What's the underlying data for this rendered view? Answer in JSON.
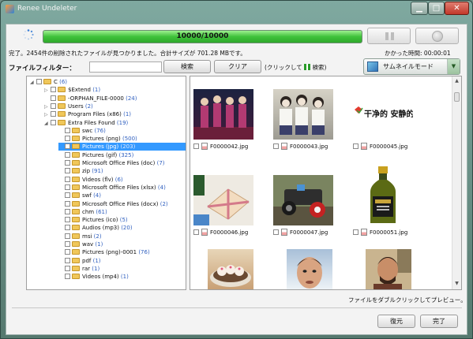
{
  "app": {
    "title": "Renee Undeleter"
  },
  "window_controls": {
    "minimize": "▁",
    "maximize": "□",
    "close": "✕"
  },
  "progress": {
    "text": "10000/10000",
    "fraction": 1.0
  },
  "status": {
    "message": "完了。2454件の削除されたファイルが見つかりました。合計サイズが 701.28 MBです。",
    "elapsed_label": "かかった時間:",
    "elapsed_value": "00:00:01"
  },
  "filter": {
    "label": "ファイルフィルター：",
    "value": "",
    "search_label": "検索",
    "clear_label": "クリア",
    "hint_prefix": "(クリックして",
    "hint_suffix": "検索)"
  },
  "view_mode": {
    "selected": "サムネイルモード"
  },
  "tree": [
    {
      "name": "C",
      "count": "(6)",
      "level": 0,
      "expander": "◢",
      "checkbox": true
    },
    {
      "name": "$Extend",
      "count": "(1)",
      "level": 1,
      "expander": "▷",
      "checkbox": true
    },
    {
      "name": "-ORPHAN_FILE-0000",
      "count": "(24)",
      "level": 1,
      "expander": "",
      "checkbox": true
    },
    {
      "name": "Users",
      "count": "(2)",
      "level": 1,
      "expander": "▷",
      "checkbox": true
    },
    {
      "name": "Program Files (x86)",
      "count": "(1)",
      "level": 1,
      "expander": "▷",
      "checkbox": true
    },
    {
      "name": "Extra Files Found",
      "count": "(19)",
      "level": 1,
      "expander": "◢",
      "checkbox": true
    },
    {
      "name": "swc",
      "count": "(76)",
      "level": 2,
      "expander": "",
      "checkbox": true
    },
    {
      "name": "Pictures (png)",
      "count": "(500)",
      "level": 2,
      "expander": "",
      "checkbox": true
    },
    {
      "name": "Pictures (jpg)",
      "count": "(203)",
      "level": 2,
      "expander": "",
      "checkbox": true,
      "selected": true
    },
    {
      "name": "Pictures (gif)",
      "count": "(325)",
      "level": 2,
      "expander": "",
      "checkbox": true
    },
    {
      "name": "Microsoft Office Files (doc)",
      "count": "(7)",
      "level": 2,
      "expander": "",
      "checkbox": true
    },
    {
      "name": "zip",
      "count": "(91)",
      "level": 2,
      "expander": "",
      "checkbox": true
    },
    {
      "name": "Videos (flv)",
      "count": "(6)",
      "level": 2,
      "expander": "",
      "checkbox": true
    },
    {
      "name": "Microsoft Office Files (xlsx)",
      "count": "(4)",
      "level": 2,
      "expander": "",
      "checkbox": true
    },
    {
      "name": "swf",
      "count": "(4)",
      "level": 2,
      "expander": "",
      "checkbox": true
    },
    {
      "name": "Microsoft Office Files (docx)",
      "count": "(2)",
      "level": 2,
      "expander": "",
      "checkbox": true
    },
    {
      "name": "chm",
      "count": "(61)",
      "level": 2,
      "expander": "",
      "checkbox": true
    },
    {
      "name": "Pictures (ico)",
      "count": "(5)",
      "level": 2,
      "expander": "",
      "checkbox": true
    },
    {
      "name": "Audios (mp3)",
      "count": "(20)",
      "level": 2,
      "expander": "",
      "checkbox": true
    },
    {
      "name": "msi",
      "count": "(2)",
      "level": 2,
      "expander": "",
      "checkbox": true
    },
    {
      "name": "wav",
      "count": "(1)",
      "level": 2,
      "expander": "",
      "checkbox": true
    },
    {
      "name": "Pictures (png)-0001",
      "count": "(76)",
      "level": 2,
      "expander": "",
      "checkbox": true
    },
    {
      "name": "pdf",
      "count": "(1)",
      "level": 2,
      "expander": "",
      "checkbox": true
    },
    {
      "name": "rar",
      "count": "(1)",
      "level": 2,
      "expander": "",
      "checkbox": true
    },
    {
      "name": "Videos (mp4)",
      "count": "(1)",
      "level": 2,
      "expander": "",
      "checkbox": true
    }
  ],
  "thumbnails": [
    {
      "filename": "F0000042.jpg",
      "image": "singers-stage-photo"
    },
    {
      "filename": "F0000043.jpg",
      "image": "schoolgirls-photo"
    },
    {
      "filename": "F0000045.jpg",
      "image": "chinese-text-logo",
      "logo_text": "干净的 安静的"
    },
    {
      "filename": "F0000046.jpg",
      "image": "gift-box-photo"
    },
    {
      "filename": "F0000047.jpg",
      "image": "toy-vehicle-photo"
    },
    {
      "filename": "F0000051.jpg",
      "image": "olive-oil-bottle-photo"
    },
    {
      "filename": "",
      "image": "dumplings-photo"
    },
    {
      "filename": "",
      "image": "man-face-photo"
    },
    {
      "filename": "",
      "image": "man-indoors-photo"
    }
  ],
  "footer": {
    "hint": "ファイルをダブルクリックしてプレビュー。",
    "restore_label": "復元",
    "done_label": "完了"
  },
  "colors": {
    "progress_green": "#3fc23a",
    "selection_blue": "#3399ff",
    "count_blue": "#2f5fbf"
  }
}
